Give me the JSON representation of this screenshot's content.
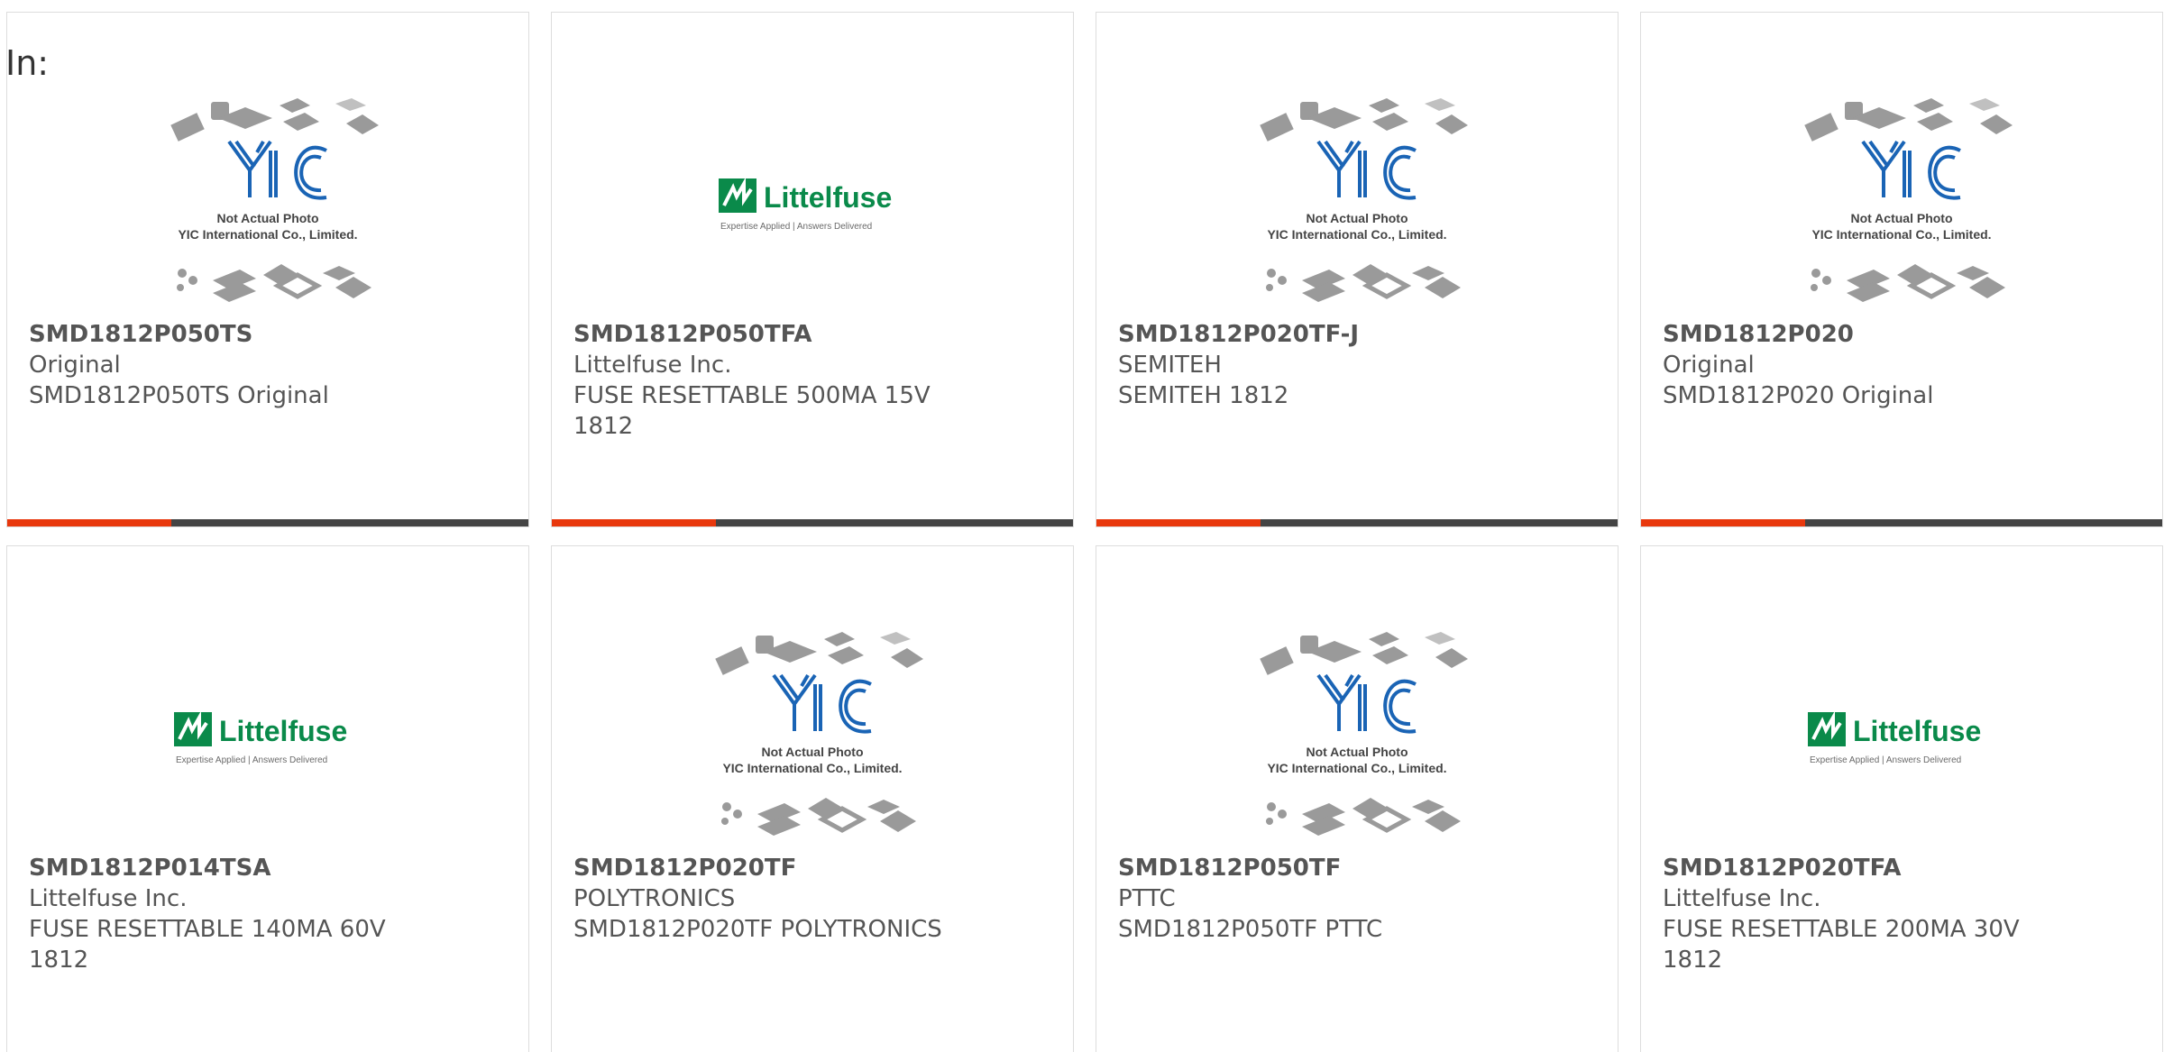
{
  "header": {
    "in_label": "In:"
  },
  "products": [
    {
      "part_number": "SMD1812P050TS",
      "manufacturer": "Original",
      "description": "SMD1812P050TS Original",
      "image": {
        "type": "yic-placeholder",
        "line1": "Not Actual Photo",
        "line2": "YIC International Co., Limited."
      }
    },
    {
      "part_number": "SMD1812P050TFA",
      "manufacturer": "Littelfuse Inc.",
      "description": "FUSE RESETTABLE 500MA 15V 1812",
      "image": {
        "type": "littelfuse-logo",
        "brand": "Littelfuse",
        "tagline": "Expertise Applied | Answers Delivered"
      }
    },
    {
      "part_number": "SMD1812P020TF-J",
      "manufacturer": "SEMITEH",
      "description": "SEMITEH 1812",
      "image": {
        "type": "yic-placeholder",
        "line1": "Not Actual Photo",
        "line2": "YIC International Co., Limited."
      }
    },
    {
      "part_number": "SMD1812P020",
      "manufacturer": "Original",
      "description": "SMD1812P020 Original",
      "image": {
        "type": "yic-placeholder",
        "line1": "Not Actual Photo",
        "line2": "YIC International Co., Limited."
      }
    },
    {
      "part_number": "SMD1812P014TSA",
      "manufacturer": "Littelfuse Inc.",
      "description": "FUSE RESETTABLE 140MA 60V 1812",
      "image": {
        "type": "littelfuse-logo",
        "brand": "Littelfuse",
        "tagline": "Expertise Applied | Answers Delivered"
      }
    },
    {
      "part_number": "SMD1812P020TF",
      "manufacturer": "POLYTRONICS",
      "description": "SMD1812P020TF POLYTRONICS",
      "image": {
        "type": "yic-placeholder",
        "line1": "Not Actual Photo",
        "line2": "YIC International Co., Limited."
      }
    },
    {
      "part_number": "SMD1812P050TF",
      "manufacturer": "PTTC",
      "description": "SMD1812P050TF PTTC",
      "image": {
        "type": "yic-placeholder",
        "line1": "Not Actual Photo",
        "line2": "YIC International Co., Limited."
      }
    },
    {
      "part_number": "SMD1812P020TFA",
      "manufacturer": "Littelfuse Inc.",
      "description": "FUSE RESETTABLE 200MA 30V 1812",
      "image": {
        "type": "littelfuse-logo",
        "brand": "Littelfuse",
        "tagline": "Expertise Applied | Answers Delivered"
      }
    }
  ],
  "colors": {
    "accent": "#e8380d",
    "bar": "#444444",
    "text": "#555555",
    "yic_blue": "#1a64b5",
    "littelfuse_green": "#0a8a4a"
  }
}
